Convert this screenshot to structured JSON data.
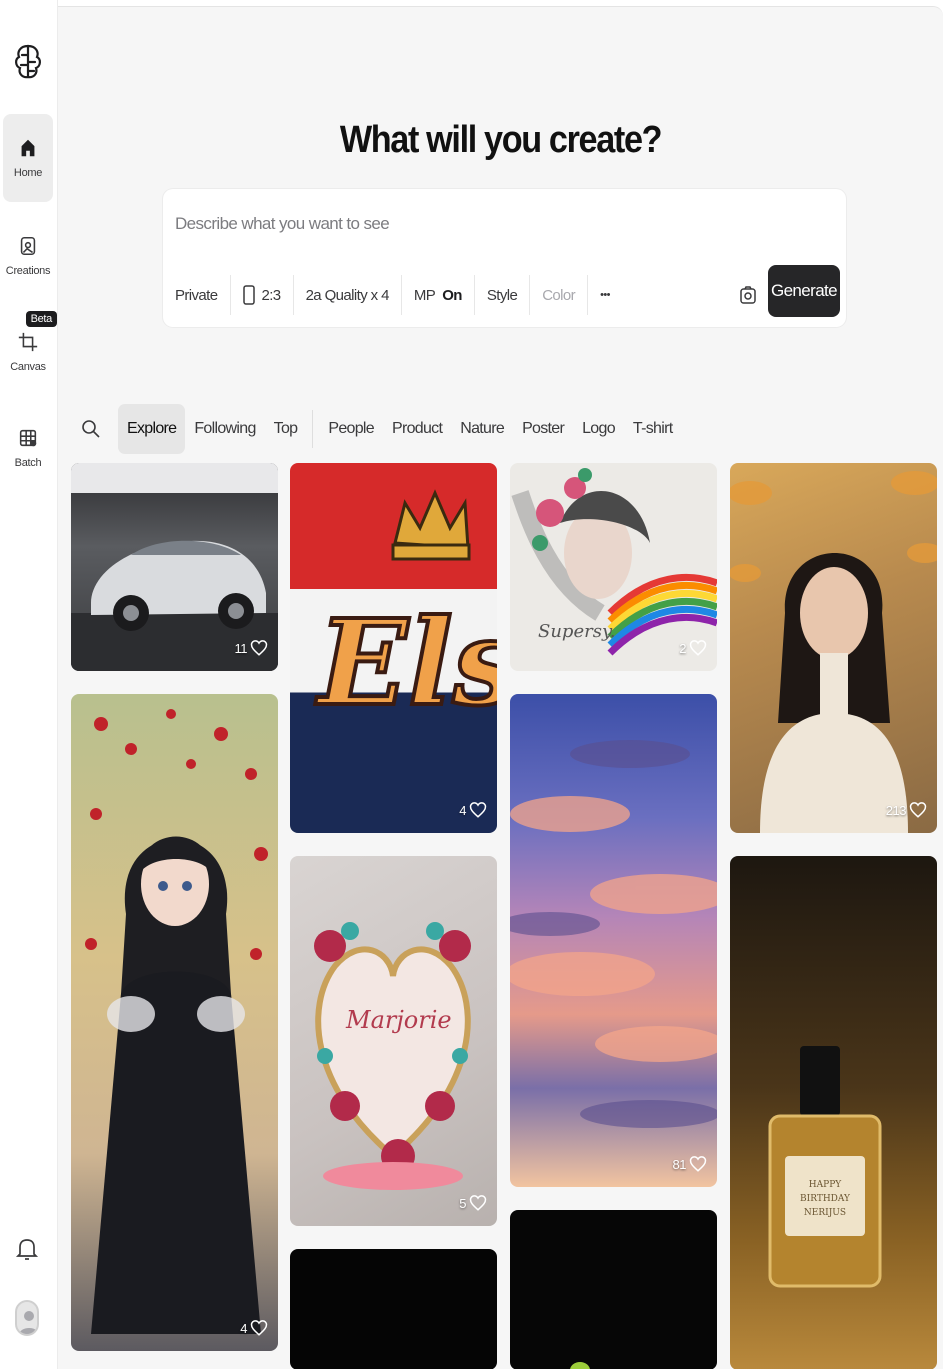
{
  "sidebar": {
    "items": [
      {
        "label": "Home",
        "icon": "home-icon",
        "active": true
      },
      {
        "label": "Creations",
        "icon": "image-icon"
      },
      {
        "label": "Canvas",
        "icon": "crop-icon",
        "badge": "Beta"
      },
      {
        "label": "Batch",
        "icon": "grid-icon"
      }
    ]
  },
  "main": {
    "headline": "What will you create?",
    "prompt": {
      "placeholder": "Describe what you want to see",
      "private": "Private",
      "ratio": "2:3",
      "quality": "2a Quality x 4",
      "mp_label": "MP",
      "mp_state": "On",
      "style": "Style",
      "color": "Color",
      "more": "•••",
      "generate": "Generate"
    },
    "filters": [
      "Explore",
      "Following",
      "Top",
      "People",
      "Product",
      "Nature",
      "Poster",
      "Logo",
      "T-shirt"
    ],
    "active_filter": "Explore"
  },
  "gallery": [
    {
      "id": "car",
      "likes": "11"
    },
    {
      "id": "els",
      "likes": "4",
      "text": "Els"
    },
    {
      "id": "rainbow-woman",
      "likes": "2",
      "text": "Supersy."
    },
    {
      "id": "portrait",
      "likes": "213"
    },
    {
      "id": "anime-girl",
      "likes": "4"
    },
    {
      "id": "heart",
      "likes": "5",
      "text": "Marjorie"
    },
    {
      "id": "clouds",
      "likes": "81"
    },
    {
      "id": "perfume",
      "text": "HAPPY BIRTHDAY NERIJUS"
    }
  ],
  "colors": {
    "accent": "#262628",
    "page": "#f6f6f6"
  }
}
